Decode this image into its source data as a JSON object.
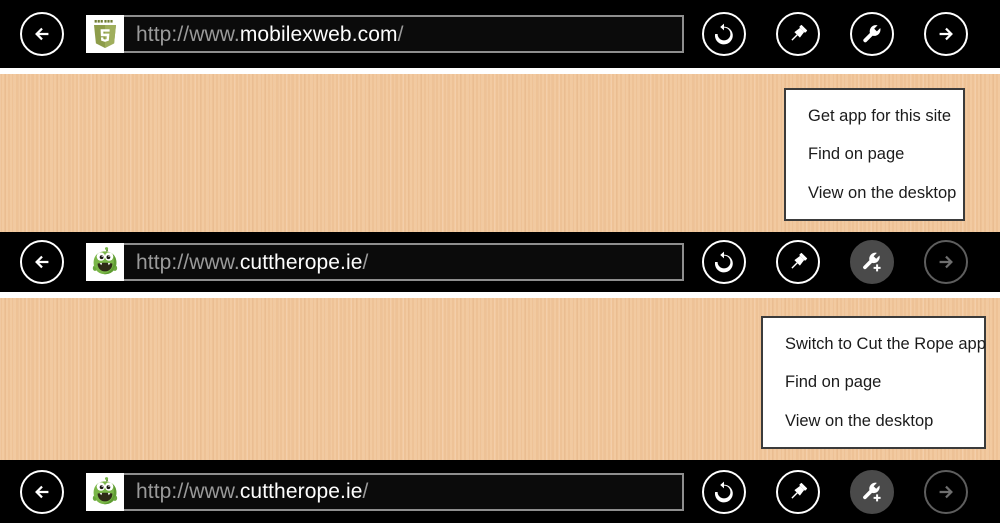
{
  "browser": {
    "back_label": "Back",
    "back_icon": "arrow-left-icon",
    "forward_label": "Forward",
    "forward_icon": "arrow-right-icon",
    "refresh_label": "Refresh",
    "refresh_icon": "refresh-icon",
    "pin_label": "Pin site",
    "pin_icon": "pin-icon",
    "tools_label": "Page tools",
    "tools_icon": "wrench-icon",
    "tools_badge_icon": "wrench-plus-icon"
  },
  "colors": {
    "chrome_background": "#000000",
    "page_background": "#f1c69b",
    "url_field_background": "#0b0b0b",
    "url_field_border": "#8e8e8e",
    "url_scheme_text": "#9a9a9a",
    "url_host_text": "#fdfdfd",
    "menu_background": "#ffffff",
    "menu_border": "#3b3b3b",
    "tools_active_fill": "#4a4a4a",
    "disabled_icon": "#6e6e6e"
  },
  "rows": [
    {
      "id": "row-mobilexweb",
      "favicon_name": "html5-shield-favicon",
      "favicon_alt": "HTML5 shield logo with number 5",
      "url": {
        "scheme": "http://www.",
        "host": "mobilexweb.com",
        "path": "/"
      },
      "tools_active": false,
      "tools_has_badge": false,
      "forward_enabled": true
    },
    {
      "id": "row-cuttherope-1",
      "favicon_name": "om-nom-favicon",
      "favicon_alt": "Green Om Nom character from Cut the Rope",
      "url": {
        "scheme": "http://www.",
        "host": "cuttherope.ie",
        "path": "/"
      },
      "tools_active": true,
      "tools_has_badge": true,
      "forward_enabled": false
    },
    {
      "id": "row-cuttherope-2",
      "favicon_name": "om-nom-favicon",
      "favicon_alt": "Green Om Nom character from Cut the Rope",
      "url": {
        "scheme": "http://www.",
        "host": "cuttherope.ie",
        "path": "/"
      },
      "tools_active": true,
      "tools_has_badge": true,
      "forward_enabled": false
    }
  ],
  "menus": [
    {
      "id": "menu-mobilexweb",
      "items": [
        "Get app for this site",
        "Find on page",
        "View on the desktop"
      ]
    },
    {
      "id": "menu-cuttherope",
      "items": [
        "Switch to Cut the Rope app",
        "Find on page",
        "View on the desktop"
      ]
    }
  ]
}
